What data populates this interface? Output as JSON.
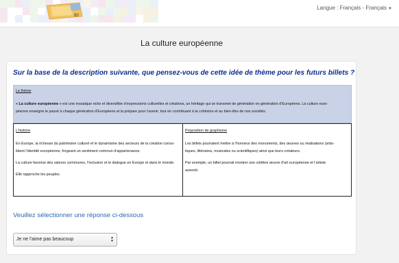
{
  "header": {
    "language_label": "Langue : Français - Français",
    "language_caret_icon": "caret-down-icon",
    "logo_icon": "banknote-icon",
    "banknote_value": "50"
  },
  "page": {
    "title": "La culture européenne"
  },
  "question": "Sur la base de la description suivante, que pensez-vous de cette idée de thème pour les futurs billets ?",
  "theme": {
    "title": "Le thème",
    "name": "« La culture européenne »",
    "line1_rest": " est une mosaïque riche et diversifiée d’expressions culturelles et créatives, un héritage qui se transmet de génération en génération d’Européens. La culture euro-",
    "line2": "péenne enseigne le passé à chaque génération d’Européens et la prépare pour l’avenir, tout en contribuant à la cohésion et au bien-être de nos sociétés."
  },
  "history": {
    "title": "L’histoire",
    "p1_line1": "En Europe, la richesse du patrimoine culturel et le dynamisme des secteurs de la création conso-",
    "p1_line2": "lident l’identité européenne, forgeant un sentiment commun d’appartenance.",
    "p2": "La culture favorise des valeurs communes, l’inclusion et le dialogue en Europe et dans le monde.",
    "p3": "Elle rapproche les peuples."
  },
  "design": {
    "title": "Proposition de graphisme",
    "p1_line1": "Les billets pourraient mettre à l’honneur des monuments, des œuvres ou réalisations (artis-",
    "p1_line2": "tiques, littéraires, musicales ou scientifiques) ainsi que leurs créateurs.",
    "p2_line1": "Par exemple, un billet pourrait montrer une célèbre œuvre d’art européenne et l’artiste",
    "p2_line2": "associé."
  },
  "answer": {
    "prompt": "Veuillez sélectionner une réponse ci-dessous",
    "selected": "Je ne l’aime pas beaucoup",
    "select_icon": "up-down-arrows-icon"
  },
  "colors": {
    "question": "#0d2c8f",
    "prompt": "#2a6ab0",
    "theme_bg": "#c9d2e6"
  }
}
